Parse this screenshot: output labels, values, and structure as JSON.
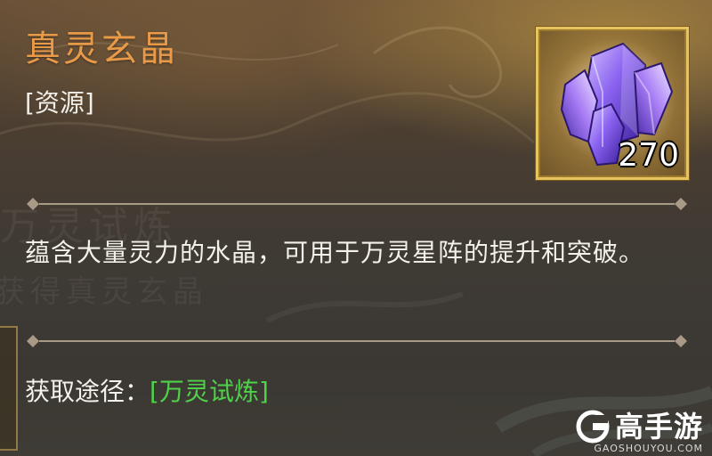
{
  "item": {
    "name": "真灵玄晶",
    "type": "[资源]",
    "count": "270",
    "icon": "purple-crystal-icon"
  },
  "description": "蕴含大量灵力的水晶，可用于万灵星阵的提升和突破。",
  "source": {
    "label": "获取途径：",
    "link": "[万灵试炼]"
  },
  "background_text": {
    "line1": "万灵试炼",
    "line2": "获得真灵玄晶"
  },
  "watermark": {
    "brand": "高手游",
    "domain": "GAOSHOUYOU.COM"
  },
  "colors": {
    "title": "#e89a48",
    "link": "#4fd24a",
    "frame": "#e7c35e"
  }
}
